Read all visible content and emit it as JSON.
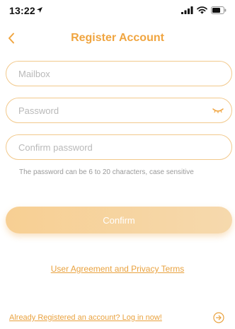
{
  "status_bar": {
    "time": "13:22",
    "icons": [
      "location-arrow-icon",
      "cellular-signal-icon",
      "wifi-icon",
      "battery-icon"
    ]
  },
  "header": {
    "back_icon": "chevron-left-icon",
    "title": "Register Account"
  },
  "form": {
    "mailbox": {
      "placeholder": "Mailbox",
      "value": ""
    },
    "password": {
      "placeholder": "Password",
      "value": "",
      "toggle_icon": "eye-closed-icon"
    },
    "confirm_password": {
      "placeholder": "Confirm password",
      "value": ""
    },
    "hint": "The password can be 6 to 20 characters, case sensitive",
    "confirm_label": "Confirm"
  },
  "links": {
    "terms": "User Agreement and Privacy Terms",
    "login": "Already Registered an account? Log in now!",
    "login_icon": "arrow-right-circle-icon"
  },
  "colors": {
    "accent": "#f0a540",
    "field_border": "#f2c98c",
    "button_start": "#f7cf93",
    "button_end": "#f6d9ad",
    "hint_text": "#9a9a9a"
  }
}
